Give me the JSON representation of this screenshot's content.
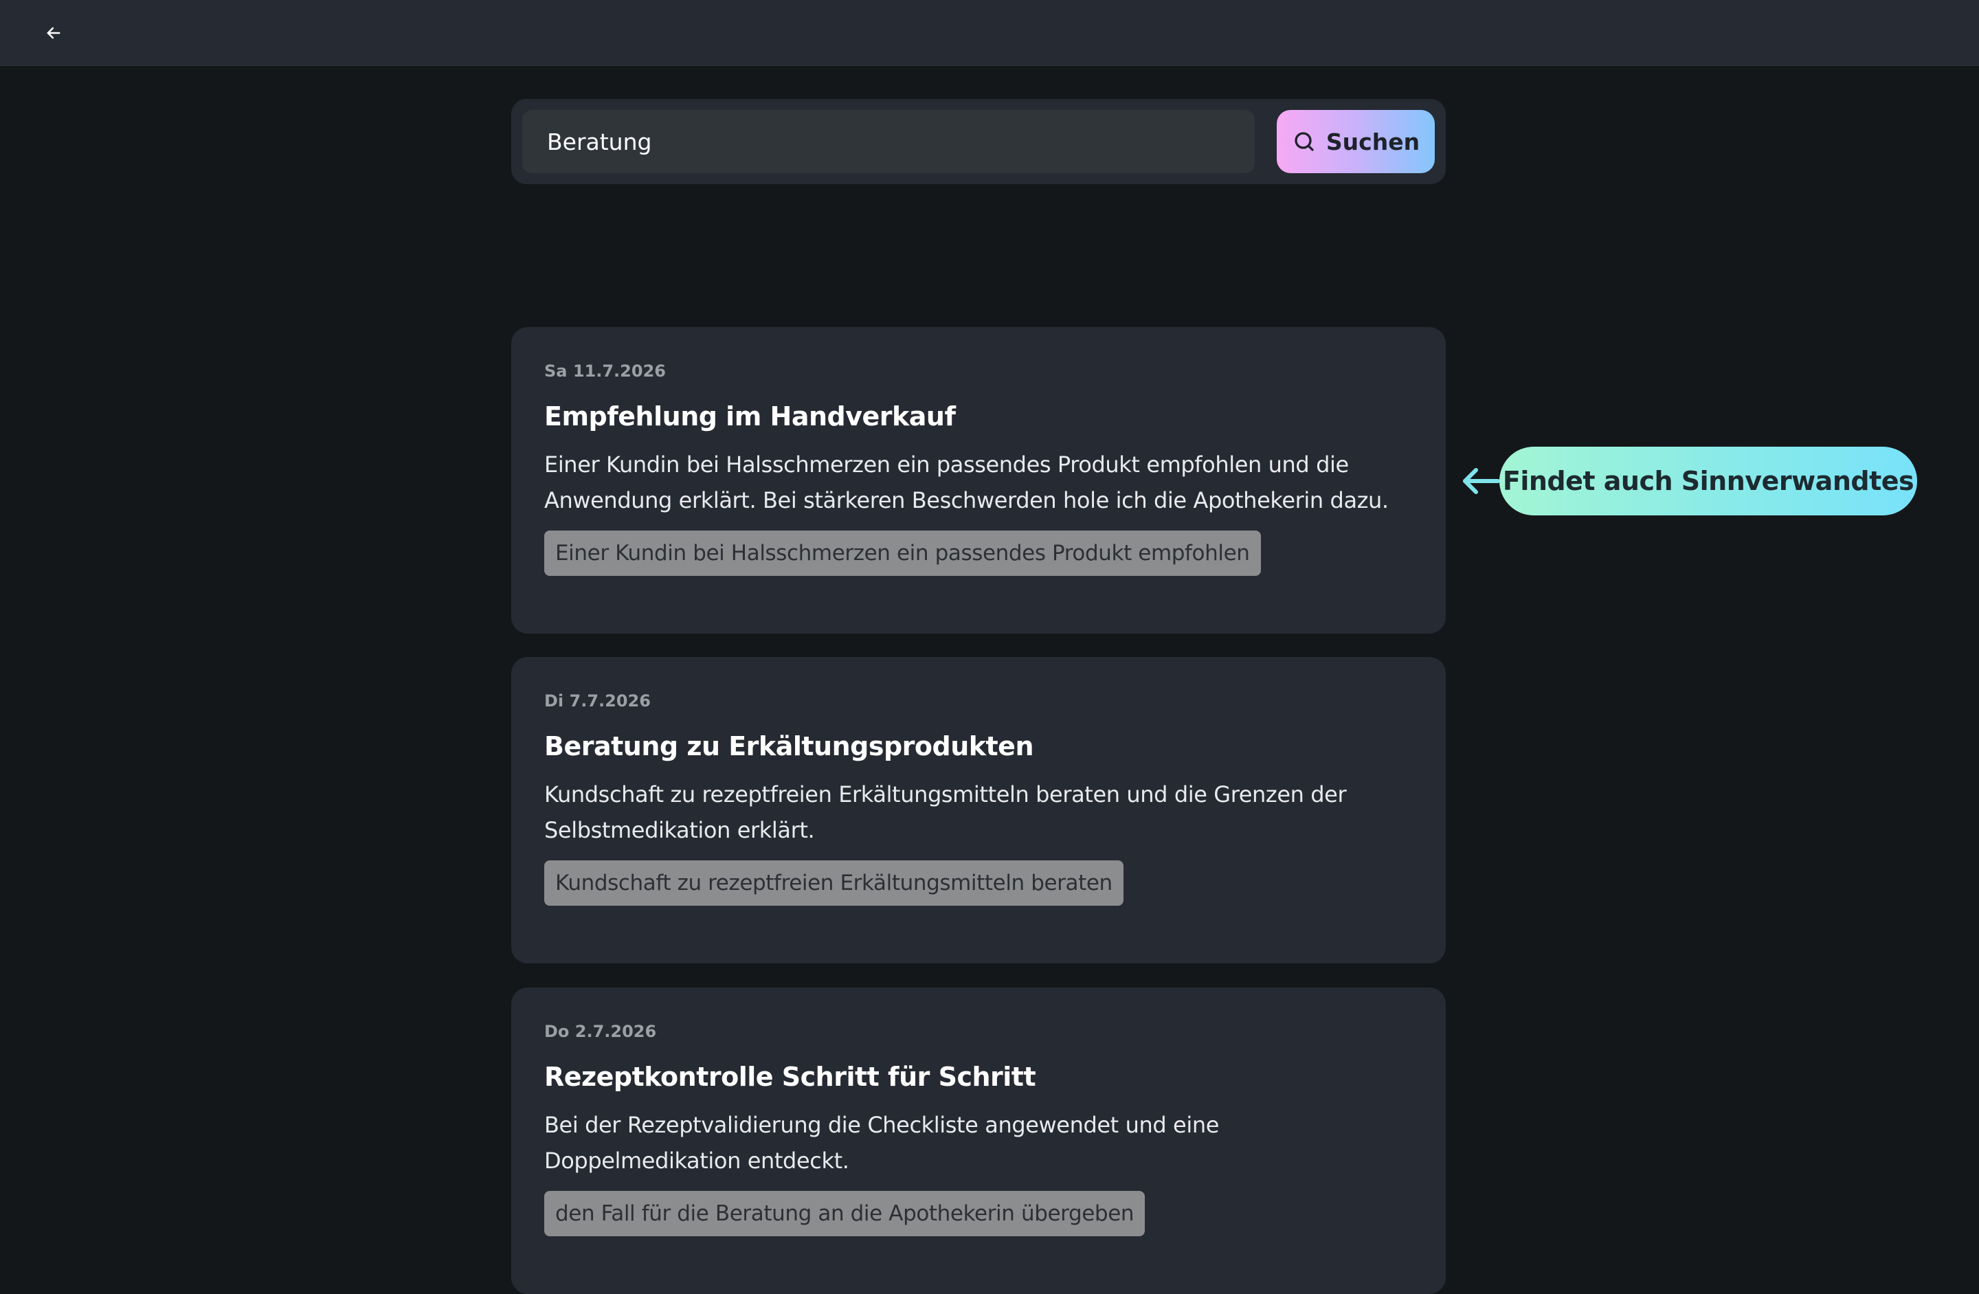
{
  "header": {
    "back_icon": "arrow-left-icon"
  },
  "search": {
    "value": "Beratung",
    "button_label": "Suchen",
    "button_icon": "search-icon",
    "button_gradient": [
      "#f7a9f4",
      "#84c6fb"
    ]
  },
  "results": [
    {
      "date": "Sa 11.7.2026",
      "title": "Empfehlung im Handverkauf",
      "body": "Einer Kundin bei Halsschmerzen ein passendes Produkt empfohlen und die Anwendung erklärt. Bei stärkeren Beschwerden hole ich die Apothekerin dazu.",
      "match": "Einer Kundin bei Halsschmerzen ein passendes Produkt empfohlen"
    },
    {
      "date": "Di 7.7.2026",
      "title": "Beratung zu Erkältungsprodukten",
      "body": "Kundschaft zu rezeptfreien Erkältungsmitteln beraten und die Grenzen der Selbstmedikation erklärt.",
      "match": "Kundschaft zu rezeptfreien Erkältungsmitteln beraten"
    },
    {
      "date": "Do 2.7.2026",
      "title": "Rezeptkontrolle Schritt für Schritt",
      "body": "Bei der Rezeptvalidierung die Checkliste angewendet und eine Doppelmedikation entdeckt.",
      "match": "den Fall für die Beratung an die Apothekerin übergeben"
    }
  ],
  "callout": {
    "label": "Findet auch Sinnverwandtes",
    "icon": "arrow-left-icon",
    "colors": [
      "#a3f5d4",
      "#78e2fa"
    ]
  },
  "colors": {
    "background": "#141719",
    "surface": "#262a32",
    "match_highlight": "#8c8d8f"
  }
}
